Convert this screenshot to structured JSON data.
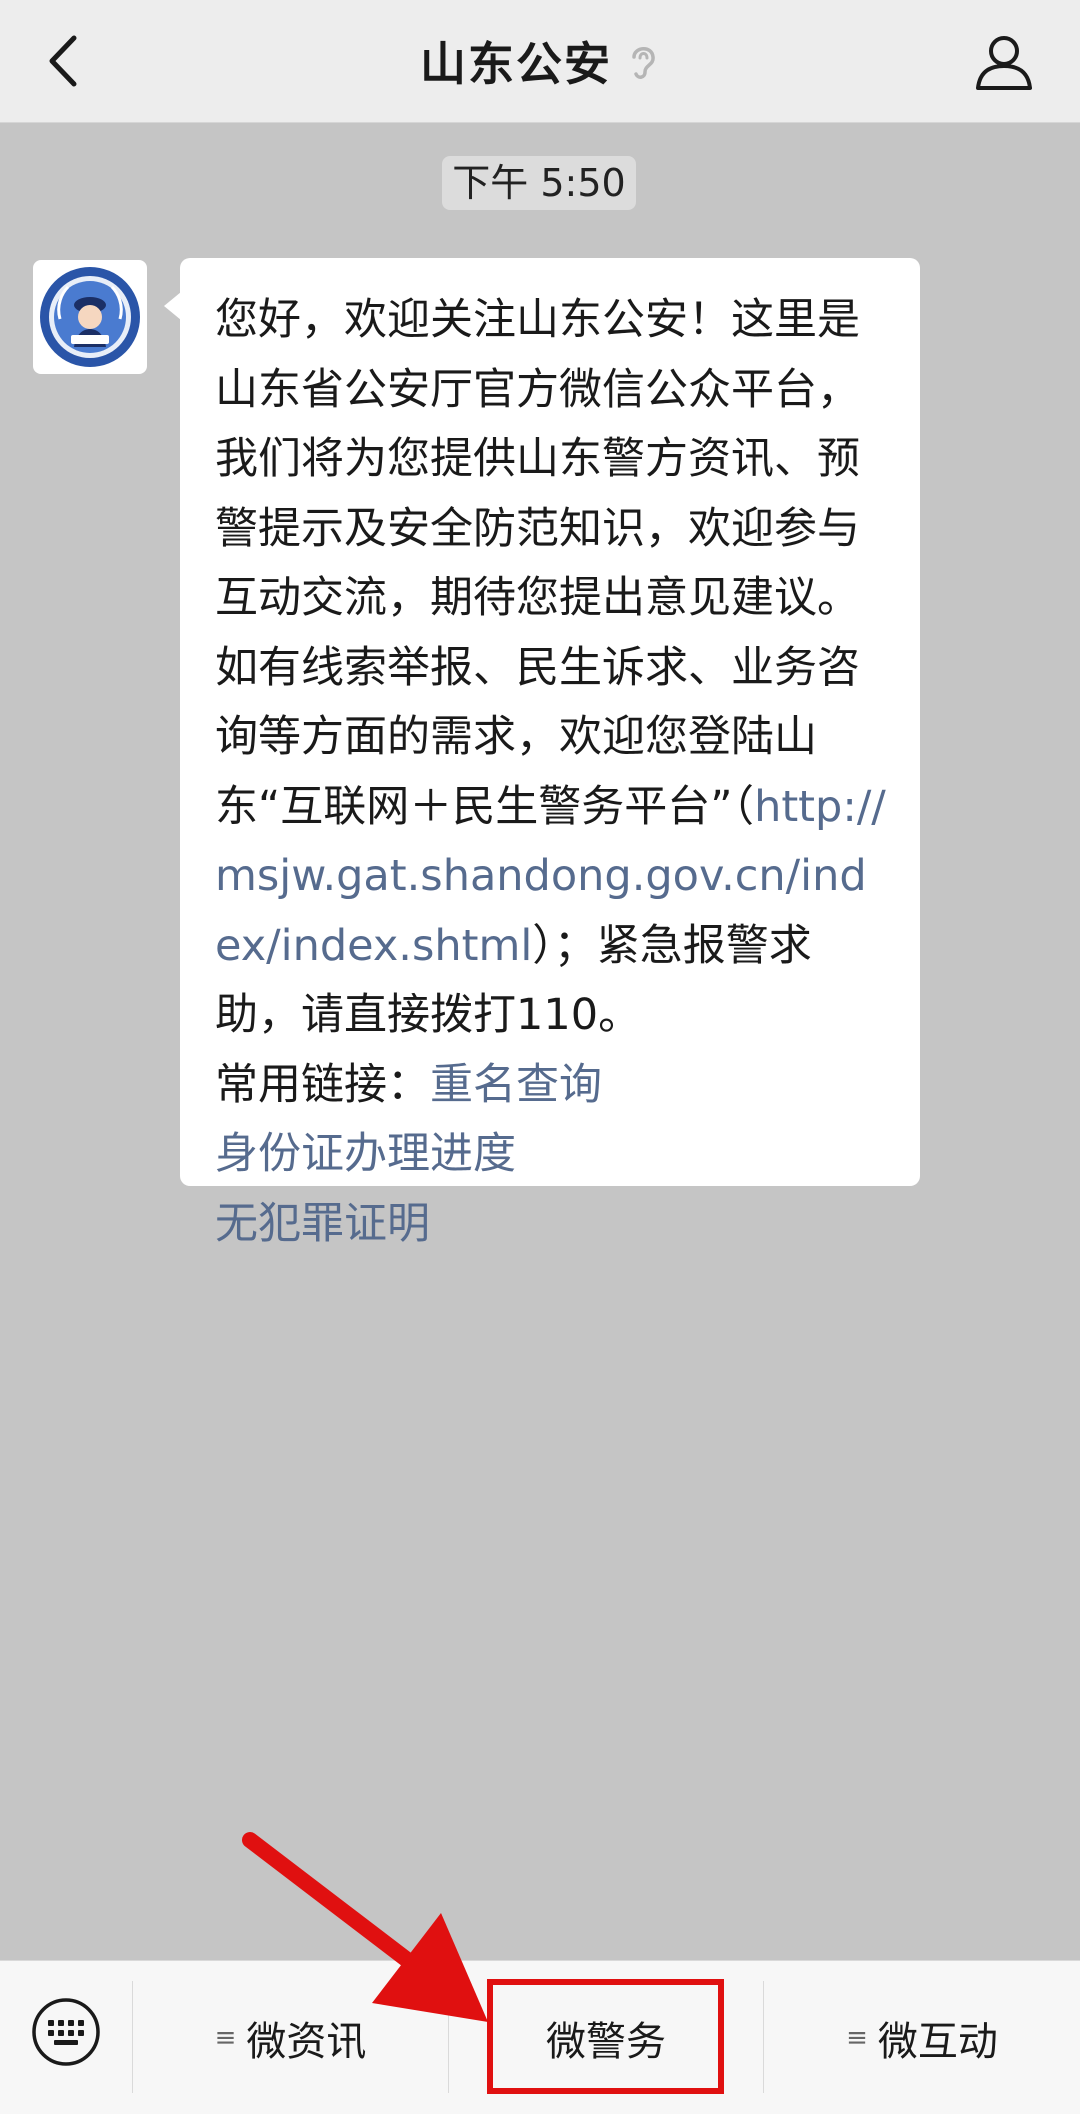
{
  "header": {
    "title": "山东公安",
    "back_icon": "chevron-left-icon",
    "ear_icon": "ear-icon",
    "profile_icon": "person-icon"
  },
  "timestamp": "下午 5:50",
  "message": {
    "text_intro": "您好，欢迎关注山东公安！这里是山东省公安厅官方微信公众平台，我们将为您提供山东警方资讯、预警提示及安全防范知识，欢迎参与互动交流，期待您提出意见建议。如有线索举报、民生诉求、业务咨询等方面的需求，欢迎您登陆山东“互联网＋民生警务平台”（",
    "url": "http://msjw.gat.shandong.gov.cn/index/index.shtml",
    "text_after_url": "）；紧急报警求助，请直接拨打110。",
    "common_links_label": "常用链接：",
    "link_1": "重名查询",
    "link_2": "身份证办理进度",
    "link_3": "无犯罪证明"
  },
  "bottom_menu": {
    "keyboard_icon": "keyboard-icon",
    "item_1": "微资讯",
    "item_2": "微警务",
    "item_3": "微互动"
  },
  "colors": {
    "chat_background": "#c5c5c5",
    "link": "#566b8e",
    "annotation": "#e01010"
  }
}
